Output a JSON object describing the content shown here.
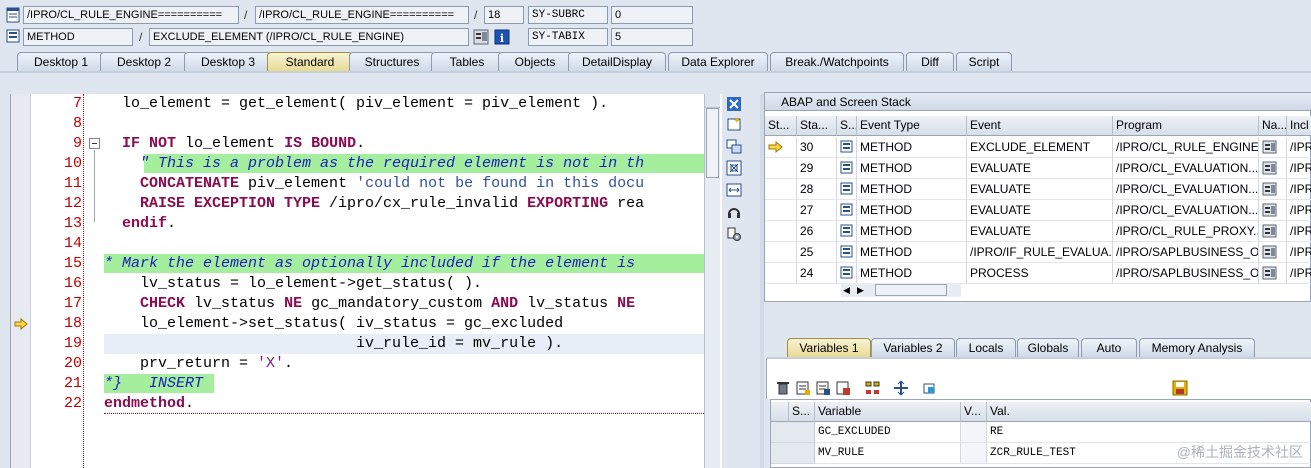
{
  "header": {
    "row1": {
      "program1": "/IPRO/CL_RULE_ENGINE==========",
      "sep1": "/",
      "program2": "/IPRO/CL_RULE_ENGINE==========",
      "sep2": "/",
      "line": "18",
      "sysfield": "SY-SUBRC",
      "sysvalue": "0"
    },
    "row2": {
      "type": "METHOD",
      "sep": "/",
      "event": "EXCLUDE_ELEMENT (/IPRO/CL_RULE_ENGINE)",
      "sysfield": "SY-TABIX",
      "sysvalue": "5"
    }
  },
  "tabs": [
    {
      "label": "Desktop 1"
    },
    {
      "label": "Desktop 2"
    },
    {
      "label": "Desktop 3"
    },
    {
      "label": "Standard"
    },
    {
      "label": "Structures"
    },
    {
      "label": "Tables"
    },
    {
      "label": "Objects"
    },
    {
      "label": "DetailDisplay"
    },
    {
      "label": "Data Explorer"
    },
    {
      "label": "Break./Watchpoints"
    },
    {
      "label": "Diff"
    },
    {
      "label": "Script"
    }
  ],
  "editor": {
    "line_numbers": [
      "7",
      "8",
      "9",
      "10",
      "11",
      "12",
      "13",
      "14",
      "15",
      "16",
      "17",
      "18",
      "19",
      "20",
      "21",
      "22"
    ],
    "current_line": "18"
  },
  "stack": {
    "title": "ABAP and Screen Stack",
    "columns": [
      "St...",
      "Sta...",
      "S...",
      "Event Type",
      "Event",
      "Program",
      "Na...",
      "Incl"
    ],
    "rows": [
      {
        "level": "30",
        "type": "METHOD",
        "event": "EXCLUDE_ELEMENT",
        "program": "/IPRO/CL_RULE_ENGINE...",
        "incl": "/IPR",
        "current": true
      },
      {
        "level": "29",
        "type": "METHOD",
        "event": "EVALUATE",
        "program": "/IPRO/CL_EVALUATION...",
        "incl": "/IPR",
        "current": false
      },
      {
        "level": "28",
        "type": "METHOD",
        "event": "EVALUATE",
        "program": "/IPRO/CL_EVALUATION...",
        "incl": "/IPR",
        "current": false
      },
      {
        "level": "27",
        "type": "METHOD",
        "event": "EVALUATE",
        "program": "/IPRO/CL_EVALUATION...",
        "incl": "/IPR",
        "current": false
      },
      {
        "level": "26",
        "type": "METHOD",
        "event": "EVALUATE",
        "program": "/IPRO/CL_RULE_PROXY...",
        "incl": "/IPR",
        "current": false
      },
      {
        "level": "25",
        "type": "METHOD",
        "event": "/IPRO/IF_RULE_EVALUA...",
        "program": "/IPRO/SAPLBUSINESS_O...",
        "incl": "/IPR",
        "current": false
      },
      {
        "level": "24",
        "type": "METHOD",
        "event": "PROCESS",
        "program": "/IPRO/SAPLBUSINESS_O...",
        "incl": "/IPR",
        "current": false
      }
    ]
  },
  "var_tabs": [
    {
      "label": "Variables 1"
    },
    {
      "label": "Variables 2"
    },
    {
      "label": "Locals"
    },
    {
      "label": "Globals"
    },
    {
      "label": "Auto"
    },
    {
      "label": "Memory Analysis"
    }
  ],
  "variables": {
    "columns": [
      "S...",
      "Variable",
      "V...",
      "Val."
    ],
    "rows": [
      {
        "name": "GC_EXCLUDED",
        "value": "RE"
      },
      {
        "name": "MV_RULE",
        "value": "ZCR_RULE_TEST"
      }
    ]
  },
  "watermark": "@稀土掘金技术社区"
}
